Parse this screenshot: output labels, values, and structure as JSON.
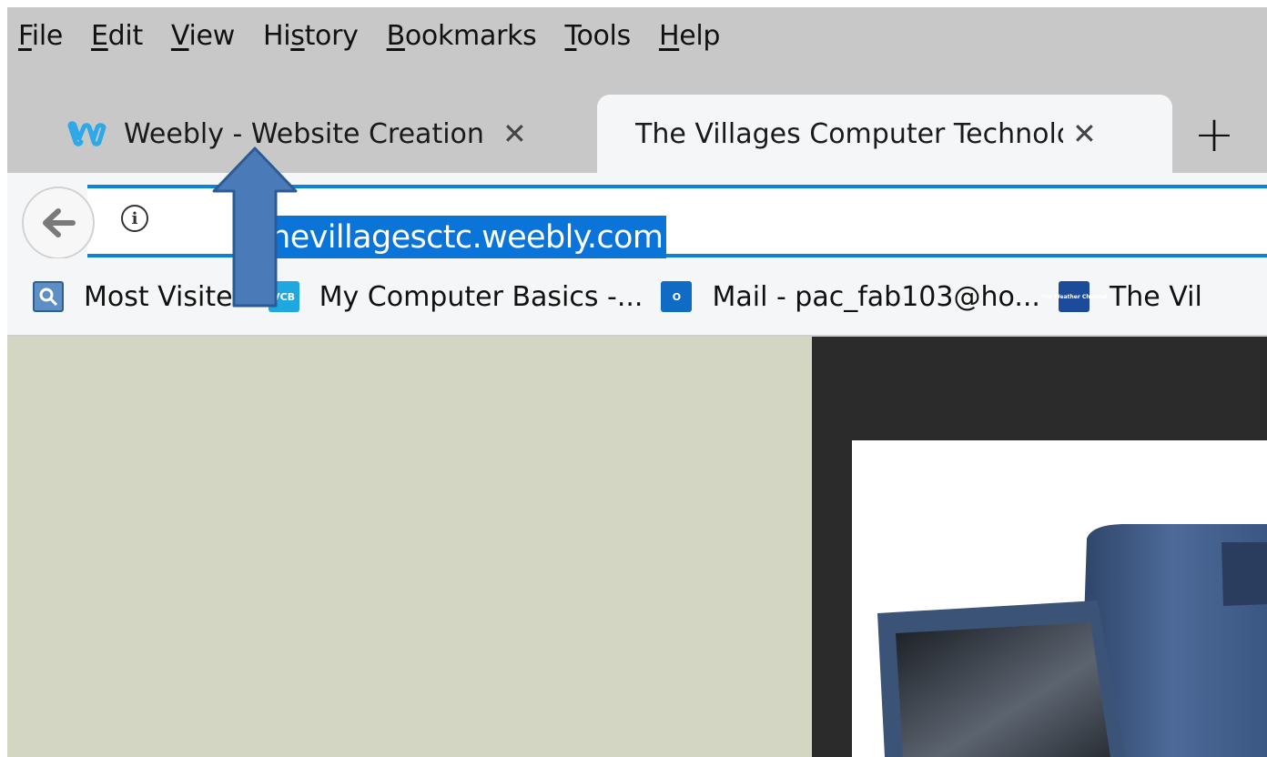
{
  "menu": {
    "file": {
      "u": "F",
      "rest": "ile"
    },
    "edit": {
      "u": "E",
      "rest": "dit"
    },
    "view": {
      "u": "V",
      "rest": "iew"
    },
    "history": {
      "pre": "Hi",
      "u": "s",
      "rest": "tory"
    },
    "bookmarks": {
      "u": "B",
      "rest": "ookmarks"
    },
    "tools": {
      "u": "T",
      "rest": "ools"
    },
    "help": {
      "u": "H",
      "rest": "elp"
    }
  },
  "tabs": [
    {
      "label": "Weebly - Website Creation M",
      "icon": "weebly-icon"
    },
    {
      "label": "The Villages Computer Technolo",
      "active": true
    }
  ],
  "newtab": "+",
  "address": {
    "url": "thevillagesctc.weebly.com",
    "selected": true
  },
  "bookmarks": [
    {
      "label": "Most Visited",
      "icon": "most-visited-icon"
    },
    {
      "label": "My Computer Basics -...",
      "icon": "vcb-icon",
      "badge": "VCB"
    },
    {
      "label": "Mail - pac_fab103@ho...",
      "icon": "outlook-icon",
      "badge": "O"
    },
    {
      "label": "The Vil",
      "icon": "weather-channel-icon",
      "badge": "The Weather Channel"
    }
  ],
  "colors": {
    "accent": "#0a84d6",
    "selection": "#0a74d9",
    "arrow": "#4a7ab8",
    "page_left": "#d2d6c3",
    "page_right": "#2b2b2b"
  }
}
